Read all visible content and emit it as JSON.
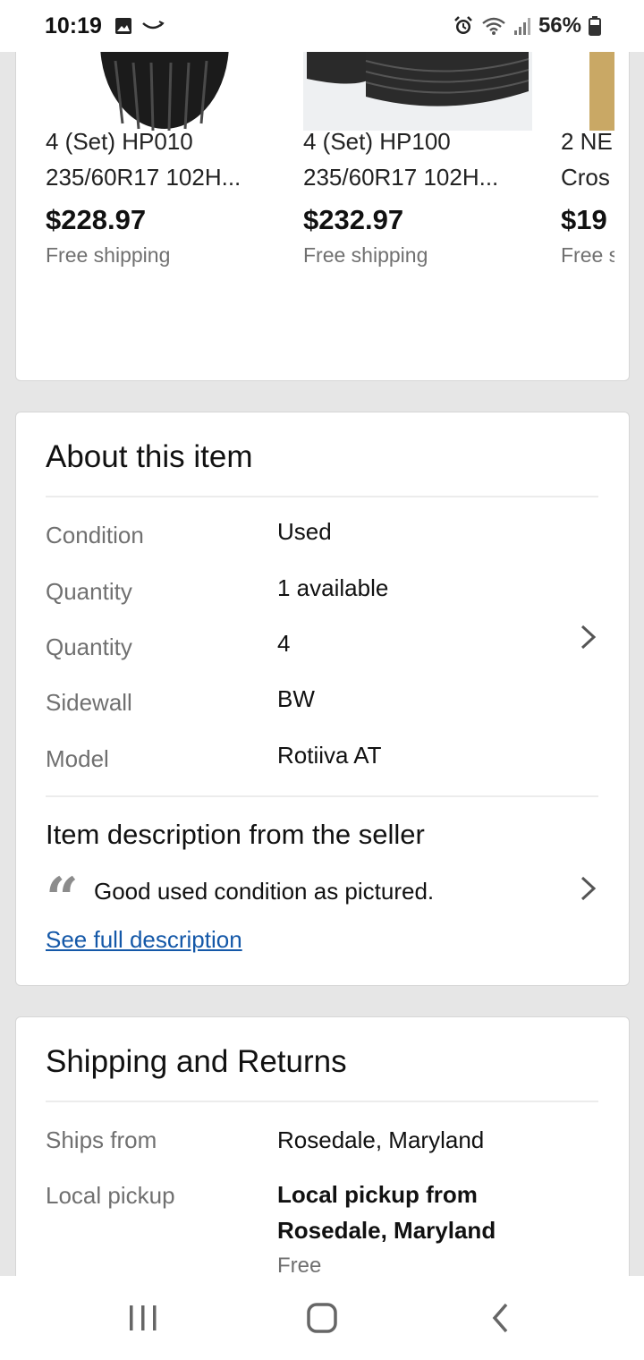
{
  "status_bar": {
    "time": "10:19",
    "battery": "56%"
  },
  "similar_items": [
    {
      "title_line1": "4 (Set) HP010",
      "title_line2": "235/60R17 102H...",
      "price": "$228.97",
      "shipping": "Free shipping"
    },
    {
      "title_line1": "4 (Set) HP100",
      "title_line2": "235/60R17 102H...",
      "price": "$232.97",
      "shipping": "Free shipping"
    },
    {
      "title_line1": "2 NE",
      "title_line2": "Cros",
      "price": "$19",
      "shipping": "Free s"
    }
  ],
  "about": {
    "title": "About this item",
    "specs": [
      {
        "label": "Condition",
        "value": "Used"
      },
      {
        "label": "Quantity",
        "value": "1 available"
      },
      {
        "label": "Quantity",
        "value": "4"
      },
      {
        "label": "Sidewall",
        "value": "BW"
      },
      {
        "label": "Model",
        "value": "Rotiiva AT"
      }
    ],
    "description_title": "Item description from the seller",
    "quote_mark": "“",
    "description_text": "Good used condition as pictured.",
    "see_full": "See full description"
  },
  "shipping": {
    "title": "Shipping and Returns",
    "ships_from_label": "Ships from",
    "ships_from_value": "Rosedale, Maryland",
    "pickup_label": "Local pickup",
    "pickup_line1": "Local pickup from",
    "pickup_line2": "Rosedale, Maryland",
    "pickup_cost": "Free"
  },
  "icons": {
    "status_left": [
      "gallery-icon",
      "smile-icon"
    ],
    "status_right": [
      "alarm-icon",
      "wifi-icon",
      "signal-icon",
      "battery-icon"
    ],
    "nav": [
      "recents-icon",
      "home-icon",
      "back-icon"
    ]
  }
}
